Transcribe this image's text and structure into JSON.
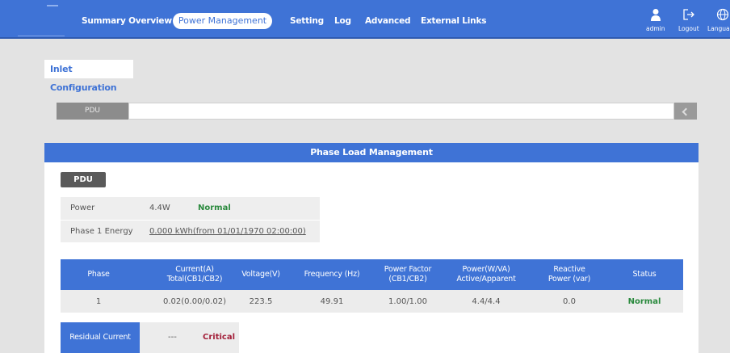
{
  "nav": {
    "items": [
      "Summary Overview",
      "Power Management",
      "Setting",
      "Log",
      "Advanced",
      "External Links"
    ],
    "active": "Power Management",
    "admin_label": "admin",
    "logout_label": "Logout",
    "language_label": "Language"
  },
  "inlet_tab": "Inlet Configuration",
  "pdu_selector": {
    "label": "PDU",
    "value": ""
  },
  "panel": {
    "title": "Phase Load Management",
    "badge": "PDU",
    "power_label": "Power",
    "power_value": "4.4W",
    "power_status": "Normal",
    "energy_label": "Phase 1 Energy",
    "energy_value": "0.000 kWh(from 01/01/1970 02:00:00)"
  },
  "table": {
    "headers": [
      [
        "Phase"
      ],
      [
        "Current(A)",
        "Total(CB1/CB2)"
      ],
      [
        "Voltage(V)"
      ],
      [
        "Frequency (Hz)"
      ],
      [
        "Power Factor",
        "(CB1/CB2)"
      ],
      [
        "Power(W/VA)",
        "Active/Apparent"
      ],
      [
        "Reactive",
        "Power (var)"
      ],
      [
        "Status"
      ]
    ],
    "rows": [
      [
        "1",
        "0.02(0.00/0.02)",
        "223.5",
        "49.91",
        "1.00/1.00",
        "4.4/4.4",
        "0.0",
        "Normal"
      ]
    ]
  },
  "residual": {
    "label": "Residual Current (mA)",
    "value": "---",
    "status": "Critical"
  },
  "colors": {
    "accent": "#3f73d6",
    "normal": "#2b8a3e",
    "critical": "#a3203a"
  }
}
